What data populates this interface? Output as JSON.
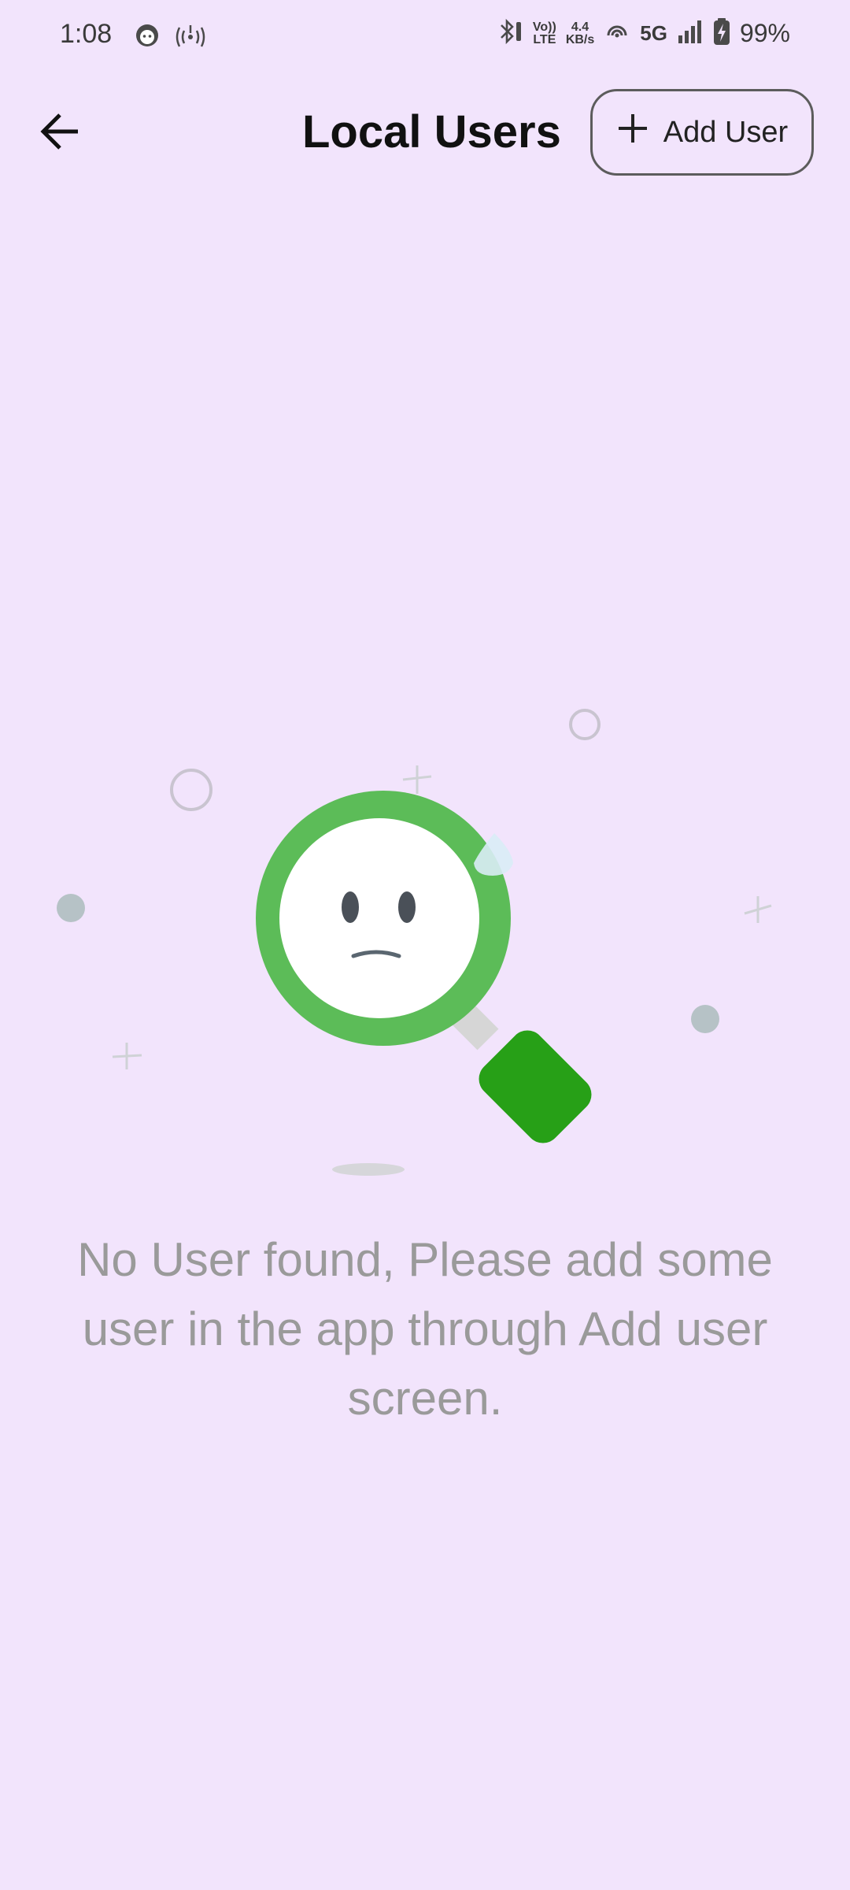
{
  "status_bar": {
    "time": "1:08",
    "network_speed_value": "4.4",
    "network_speed_unit": "KB/s",
    "volte_top": "Vo))",
    "volte_bottom": "LTE",
    "network_type": "5G",
    "battery_percent": "99%",
    "icons": [
      "face-icon",
      "hotspot-icon",
      "bluetooth-icon",
      "volte-icon",
      "wifi-calling-icon",
      "signal-icon",
      "battery-charging-icon"
    ]
  },
  "app_bar": {
    "title": "Local Users",
    "add_user_label": "Add User",
    "icons": [
      "back-arrow-icon",
      "plus-icon"
    ]
  },
  "empty_state": {
    "message": "No User found, Please add some user in the app through Add user screen.",
    "illustration": "sad-magnifier-illustration",
    "colors": {
      "lens_ring": "#5cbc58",
      "handle": "#27a017",
      "text": "#9a9a9a",
      "background": "#f2e4fc"
    }
  }
}
